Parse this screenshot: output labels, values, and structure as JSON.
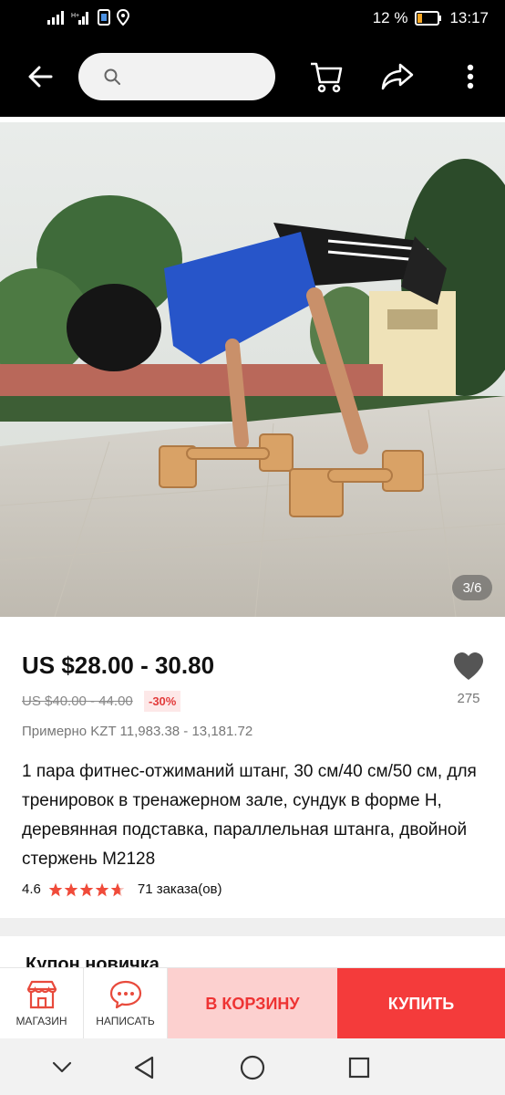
{
  "status_bar": {
    "battery": "12 %",
    "time": "13:17"
  },
  "header": {
    "back_icon": "arrow-left-icon",
    "search_placeholder": "",
    "cart_icon": "cart-icon",
    "share_icon": "share-icon",
    "more_icon": "more-vertical-icon"
  },
  "gallery": {
    "counter": "3/6"
  },
  "product": {
    "price": "US $28.00 - 30.80",
    "old_price": "US $40.00 - 44.00",
    "discount": "-30%",
    "approx_price": "Примерно KZT 11,983.38 - 13,181.72",
    "likes": "275",
    "title": "1 пара фитнес-отжиманий штанг, 30 см/40 см/50 см, для тренировок в тренажерном зале, сундук в форме H, деревянная подставка, параллельная штанга, двойной стержень M2128",
    "rating": "4.6",
    "stars_value": 4.6,
    "orders": "71 заказа(ов)"
  },
  "coupon": {
    "label": "Купон новичка"
  },
  "action_bar": {
    "store_label": "МАГАЗИН",
    "message_label": "НАПИСАТЬ",
    "cart_label": "В КОРЗИНУ",
    "buy_label": "КУПИТЬ"
  },
  "colors": {
    "accent": "#f43b3b",
    "accent_light": "#fcd0cf",
    "star": "#f04b3a"
  }
}
